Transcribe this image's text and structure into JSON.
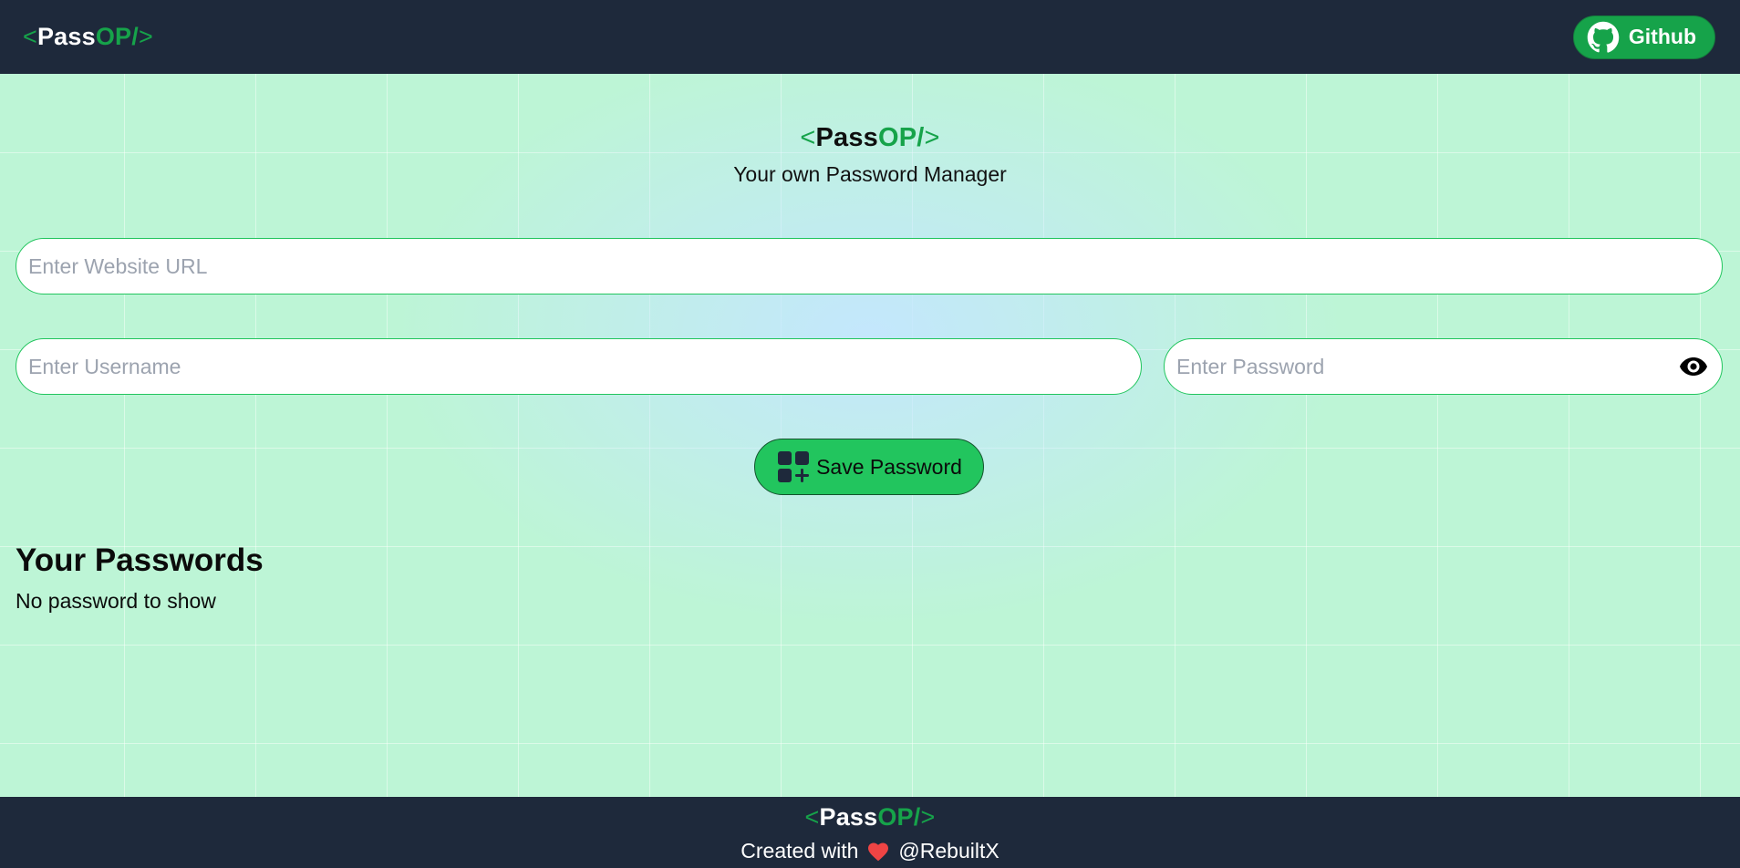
{
  "navbar": {
    "logo": {
      "open": "<",
      "pass": "Pass",
      "op": "OP/",
      "close": ">"
    },
    "github_label": "Github"
  },
  "hero": {
    "logo": {
      "open": "<",
      "pass": "Pass",
      "op": "OP/",
      "close": ">"
    },
    "tagline": "Your own Password Manager"
  },
  "form": {
    "url_placeholder": "Enter Website URL",
    "url_value": "",
    "username_placeholder": "Enter Username",
    "username_value": "",
    "password_placeholder": "Enter Password",
    "password_value": "",
    "save_label": "Save Password"
  },
  "passwords": {
    "title": "Your Passwords",
    "empty_message": "No password to show"
  },
  "footer": {
    "logo": {
      "open": "<",
      "pass": "Pass",
      "op": "OP/",
      "close": ">"
    },
    "created_with": "Created with",
    "author": "@RebuiltX"
  },
  "colors": {
    "nav_bg": "#1e293b",
    "accent": "#22c55e",
    "accent_dark": "#16a34a",
    "page_bg": "#bdf5d6"
  },
  "icons": {
    "github": "github-icon",
    "eye": "eye-icon",
    "save": "add-grid-icon",
    "heart": "heart-icon"
  }
}
